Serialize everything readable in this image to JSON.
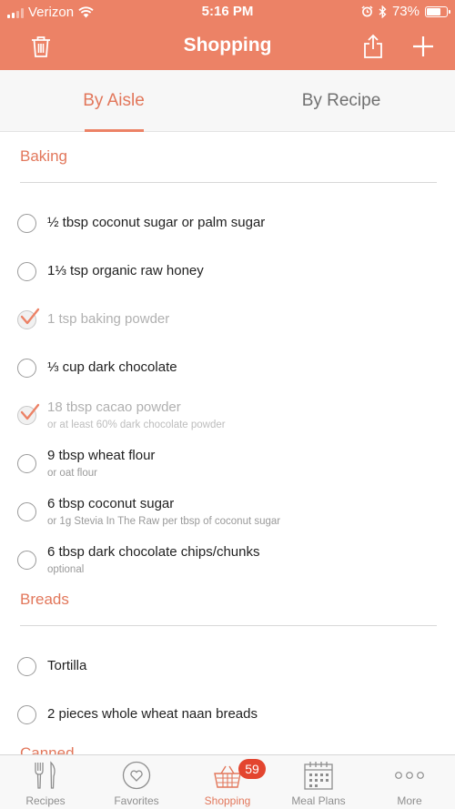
{
  "status_bar": {
    "carrier": "Verizon",
    "time": "5:16 PM",
    "battery": "73%",
    "battery_level": 0.73
  },
  "header": {
    "title": "Shopping",
    "icons": [
      "trash-icon",
      "share-icon",
      "plus-icon"
    ]
  },
  "tabs": [
    {
      "label": "By Aisle",
      "selected": true
    },
    {
      "label": "By Recipe",
      "selected": false
    }
  ],
  "sections": [
    {
      "name": "Baking",
      "items": [
        {
          "name": "½ tbsp coconut sugar or palm sugar",
          "note": "",
          "checked": false
        },
        {
          "name": "1⅓ tsp organic raw honey",
          "note": "",
          "checked": false
        },
        {
          "name": "1 tsp baking powder",
          "note": "",
          "checked": true
        },
        {
          "name": "⅓ cup dark chocolate",
          "note": "",
          "checked": false
        },
        {
          "name": "18 tbsp cacao powder",
          "note": "or at least 60% dark chocolate powder",
          "checked": true
        },
        {
          "name": "9 tbsp wheat flour",
          "note": "or oat flour",
          "checked": false
        },
        {
          "name": "6 tbsp coconut sugar",
          "note": "or 1g Stevia In The Raw per tbsp of coconut sugar",
          "checked": false
        },
        {
          "name": "6 tbsp dark chocolate chips/chunks",
          "note": "optional",
          "checked": false
        }
      ]
    },
    {
      "name": "Breads",
      "items": [
        {
          "name": "Tortilla",
          "note": "",
          "checked": false
        },
        {
          "name": "2 pieces whole wheat naan breads",
          "note": "",
          "checked": false
        }
      ]
    },
    {
      "name": "Canned",
      "items": []
    }
  ],
  "tab_bar": {
    "items": [
      {
        "label": "Recipes",
        "icon": "fork-knife-icon",
        "active": false
      },
      {
        "label": "Favorites",
        "icon": "heart-icon",
        "active": false
      },
      {
        "label": "Shopping",
        "icon": "basket-icon",
        "active": true,
        "badge": "59"
      },
      {
        "label": "Meal Plans",
        "icon": "calendar-icon",
        "active": false
      },
      {
        "label": "More",
        "icon": "more-icon",
        "active": false
      }
    ]
  },
  "colors": {
    "accent": "#ec8266",
    "accent_text": "#e2775b",
    "badge": "#e3452f"
  }
}
